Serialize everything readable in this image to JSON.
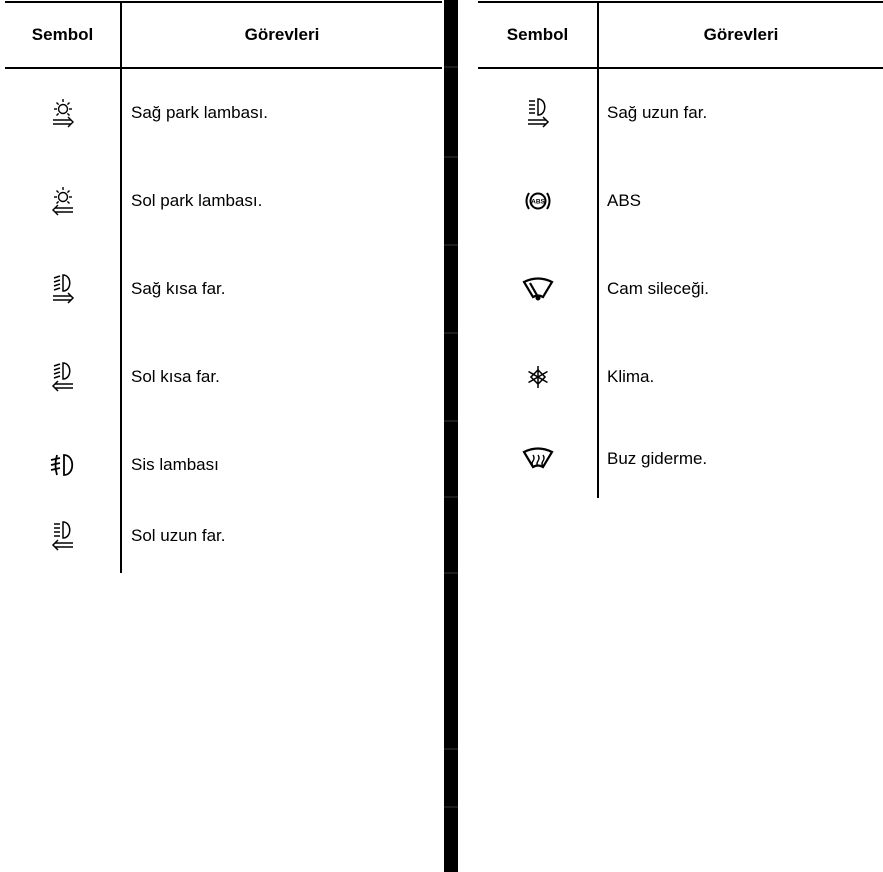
{
  "left_table": {
    "header": {
      "symbol": "Sembol",
      "function": "Görevleri"
    },
    "rows": [
      {
        "icon": "parking-light-right-icon",
        "label": "Sağ park lambası."
      },
      {
        "icon": "parking-light-left-icon",
        "label": "Sol park lambası."
      },
      {
        "icon": "low-beam-right-icon",
        "label": "Sağ kısa far."
      },
      {
        "icon": "low-beam-left-icon",
        "label": "Sol kısa far."
      },
      {
        "icon": "fog-light-icon",
        "label": "Sis lambası"
      },
      {
        "icon": "high-beam-left-icon",
        "label": "Sol uzun far."
      }
    ]
  },
  "right_table": {
    "header": {
      "symbol": "Sembol",
      "function": "Görevleri"
    },
    "rows": [
      {
        "icon": "high-beam-right-icon",
        "label": "Sağ uzun far."
      },
      {
        "icon": "abs-icon",
        "label": "ABS"
      },
      {
        "icon": "wiper-icon",
        "label": "Cam sileceği."
      },
      {
        "icon": "air-conditioning-icon",
        "label": "Klima."
      },
      {
        "icon": "defrost-icon",
        "label": "Buz giderme."
      }
    ]
  },
  "colors": {
    "text": "#000000",
    "background": "#ffffff",
    "rule": "#000000"
  }
}
